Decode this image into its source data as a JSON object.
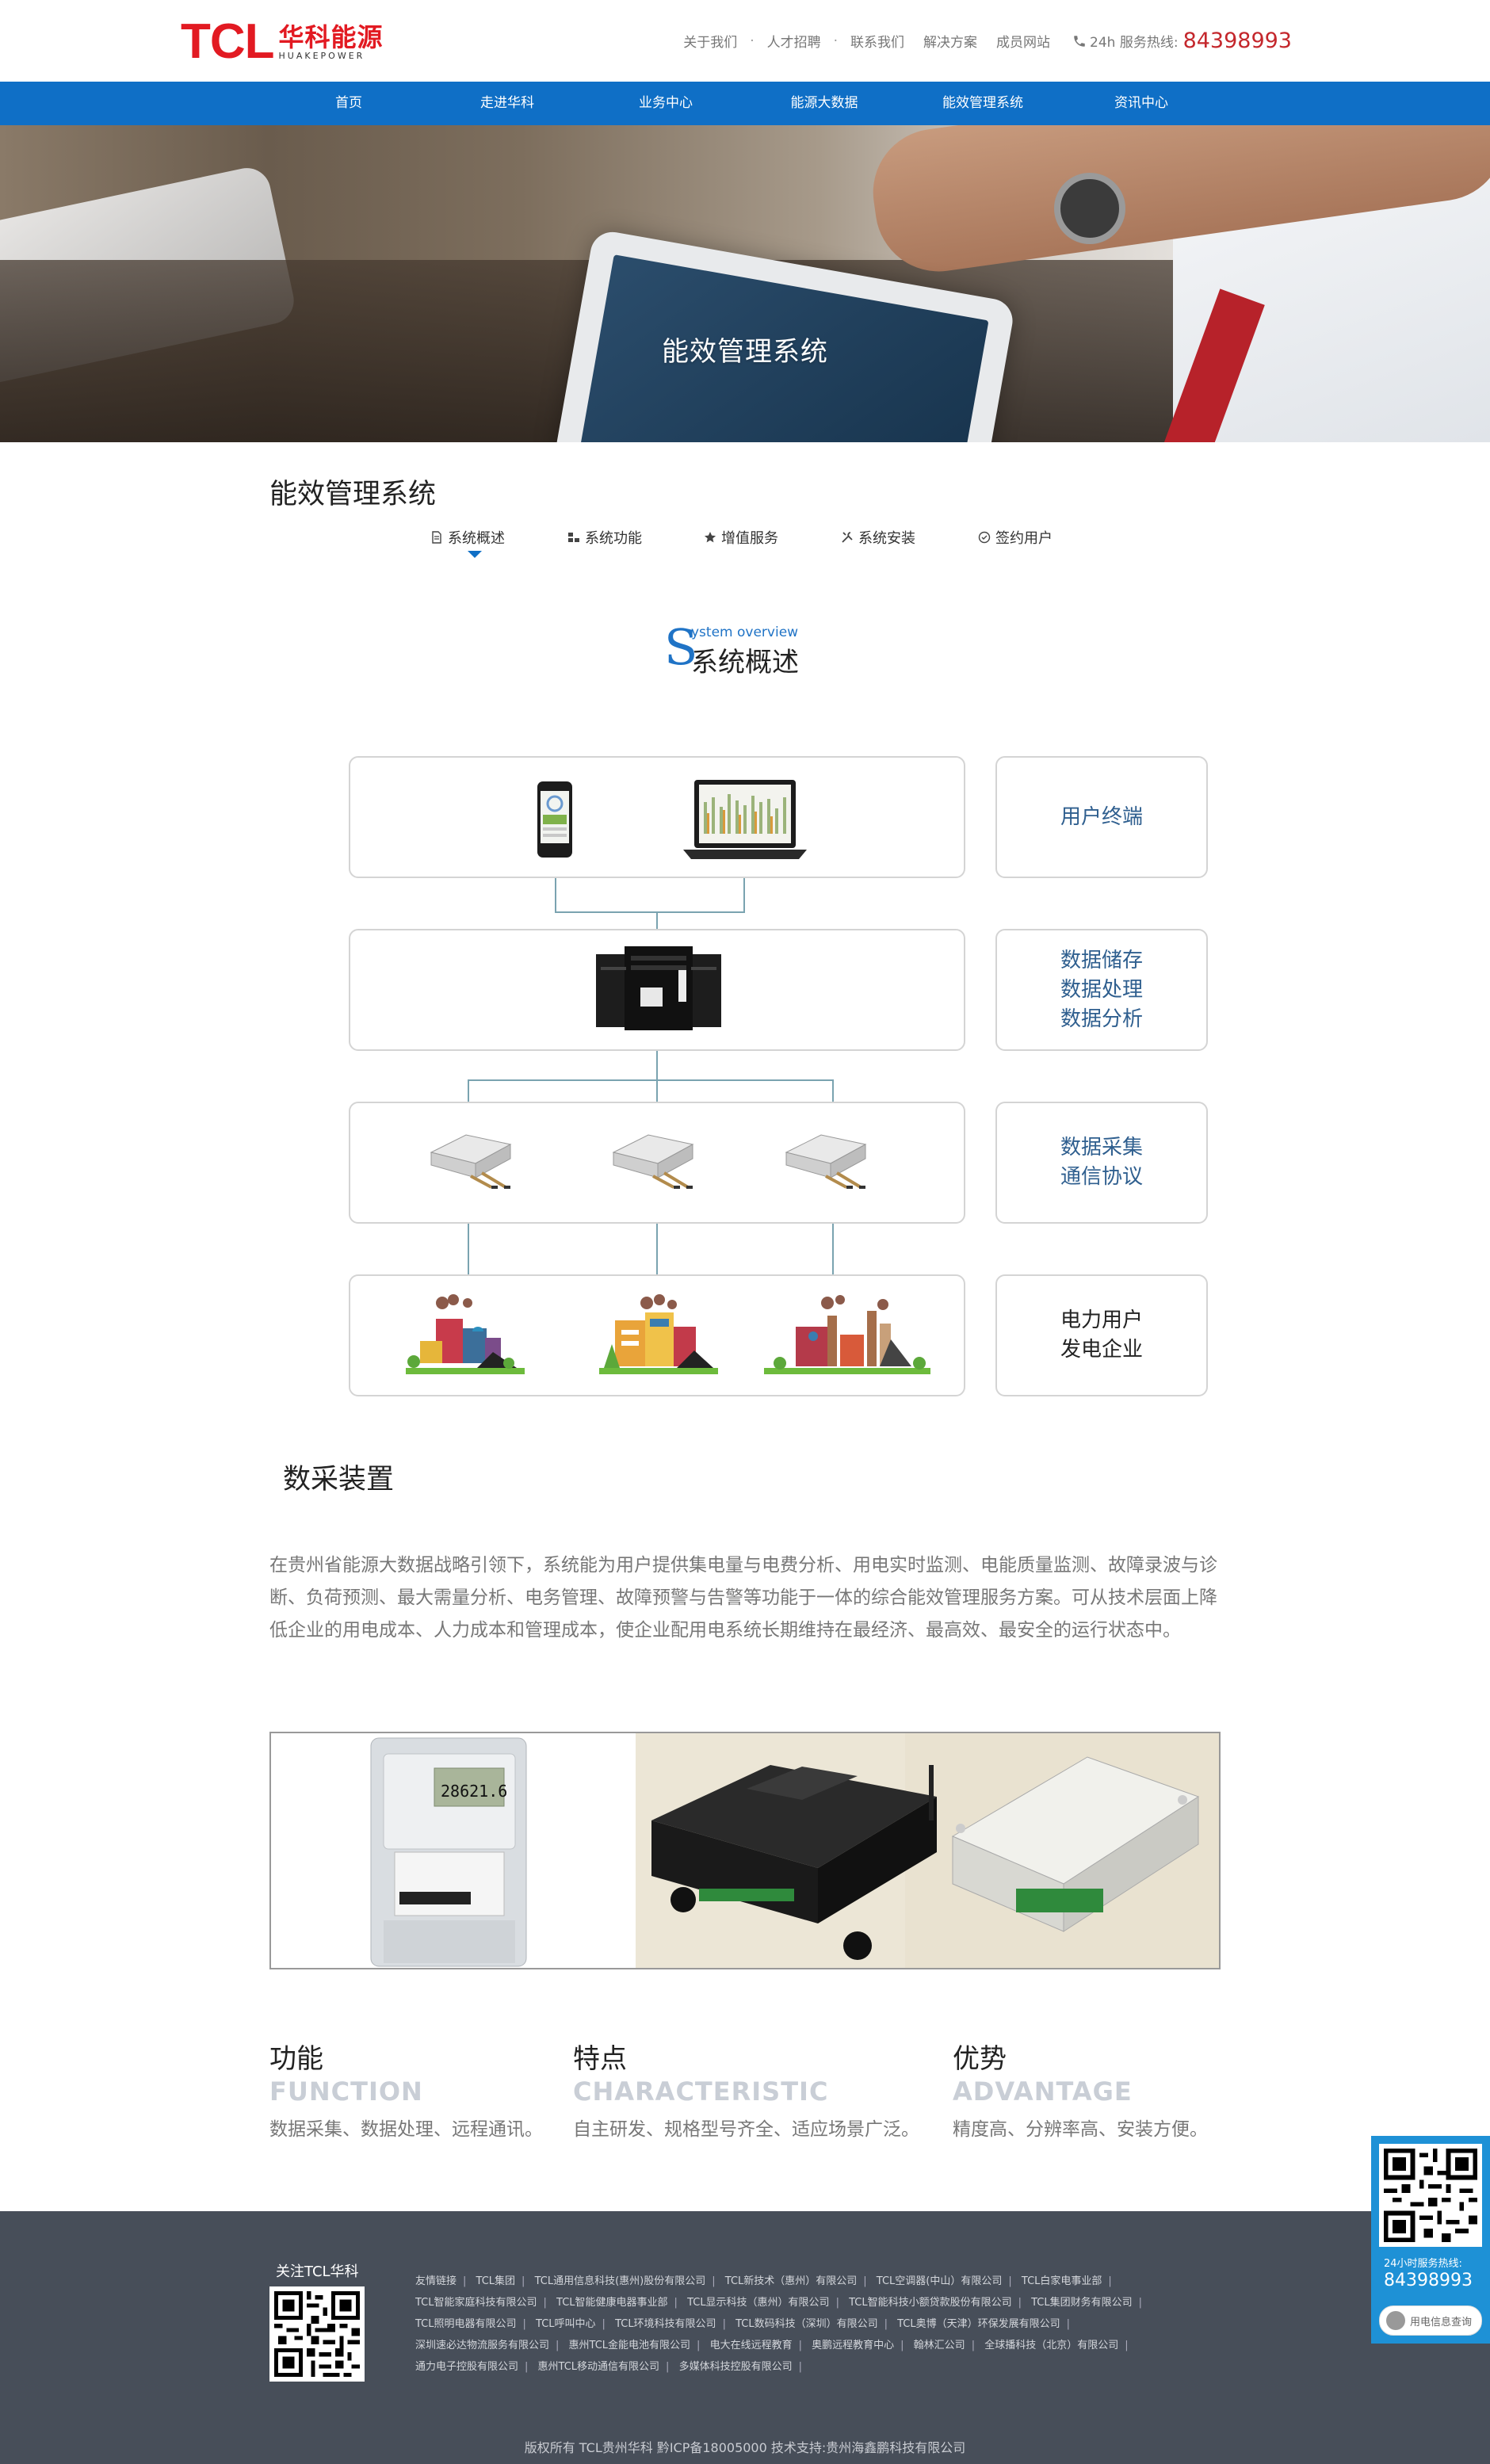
{
  "header": {
    "logo_tcl": "TCL",
    "logo_cn": "华科能源",
    "logo_en": "HUAKEPOWER",
    "top_links": [
      "关于我们",
      "人才招聘",
      "联系我们",
      "解决方案",
      "成员网站"
    ],
    "separator": "·",
    "hotline_label": "24h 服务热线:",
    "hotline_number": "84398993"
  },
  "nav": {
    "items": [
      "首页",
      "走进华科",
      "业务中心",
      "能源大数据",
      "能效管理系统",
      "资讯中心"
    ]
  },
  "banner": {
    "title": "能效管理系统"
  },
  "section": {
    "title": "能效管理系统",
    "tabs": [
      {
        "label": "系统概述",
        "icon": "document-icon",
        "active": true
      },
      {
        "label": "系统功能",
        "icon": "blocks-icon",
        "active": false
      },
      {
        "label": "增值服务",
        "icon": "star-icon",
        "active": false
      },
      {
        "label": "系统安装",
        "icon": "tools-icon",
        "active": false
      },
      {
        "label": "签约用户",
        "icon": "check-circle-icon",
        "active": false
      }
    ]
  },
  "overview": {
    "letter": "S",
    "en": "ystem overview",
    "cn": "系统概述"
  },
  "diagram": {
    "labels": [
      [
        "用户终端"
      ],
      [
        "数据储存",
        "数据处理",
        "数据分析"
      ],
      [
        "数据采集",
        "通信协议"
      ],
      [
        "电力用户",
        "发电企业"
      ]
    ]
  },
  "device_section": {
    "title": "数采装置",
    "paragraph": "在贵州省能源大数据战略引领下，系统能为用户提供集电量与电费分析、用电实时监测、电能质量监测、故障录波与诊断、负荷预测、最大需量分析、电务管理、故障预警与告警等功能于一体的综合能效管理服务方案。可从技术层面上降低企业的用电成本、人力成本和管理成本，使企业配用电系统长期维持在最经济、最高效、最安全的运行状态中。",
    "meter_reading": "28621.6"
  },
  "features": [
    {
      "cn": "功能",
      "en": "FUNCTION",
      "desc": "数据采集、数据处理、远程通讯。"
    },
    {
      "cn": "特点",
      "en": "CHARACTERISTIC",
      "desc": "自主研发、规格型号齐全、适应场景广泛。"
    },
    {
      "cn": "优势",
      "en": "ADVANTAGE",
      "desc": "精度高、分辨率高、安装方便。"
    }
  ],
  "footer": {
    "follow": "关注TCL华科",
    "links": [
      "友情链接",
      "TCL集团",
      "TCL通用信息科技(惠州)股份有限公司",
      "TCL新技术（惠州）有限公司",
      "TCL空调器(中山）有限公司",
      "TCL白家电事业部",
      "TCL智能家庭科技有限公司",
      "TCL智能健康电器事业部",
      "TCL显示科技（惠州）有限公司",
      "TCL智能科技小额贷款股份有限公司",
      "TCL集团财务有限公司",
      "TCL照明电器有限公司",
      "TCL呼叫中心",
      "TCL环境科技有限公司",
      "TCL数码科技（深圳）有限公司",
      "TCL奥博（天津）环保发展有限公司",
      "深圳速必达物流服务有限公司",
      "惠州TCL金能电池有限公司",
      "电大在线远程教育",
      "奥鹏远程教育中心",
      "翰林汇公司",
      "全球播科技（北京）有限公司",
      "通力电子控股有限公司",
      "惠州TCL移动通信有限公司",
      "多媒体科技控股有限公司"
    ],
    "copyright": "版权所有 TCL贵州华科  黔ICP备18005000 技术支持:贵州海鑫鹏科技有限公司"
  },
  "side_widget": {
    "label": "24小时服务热线:",
    "number": "84398993",
    "button": "用电信息查询"
  }
}
